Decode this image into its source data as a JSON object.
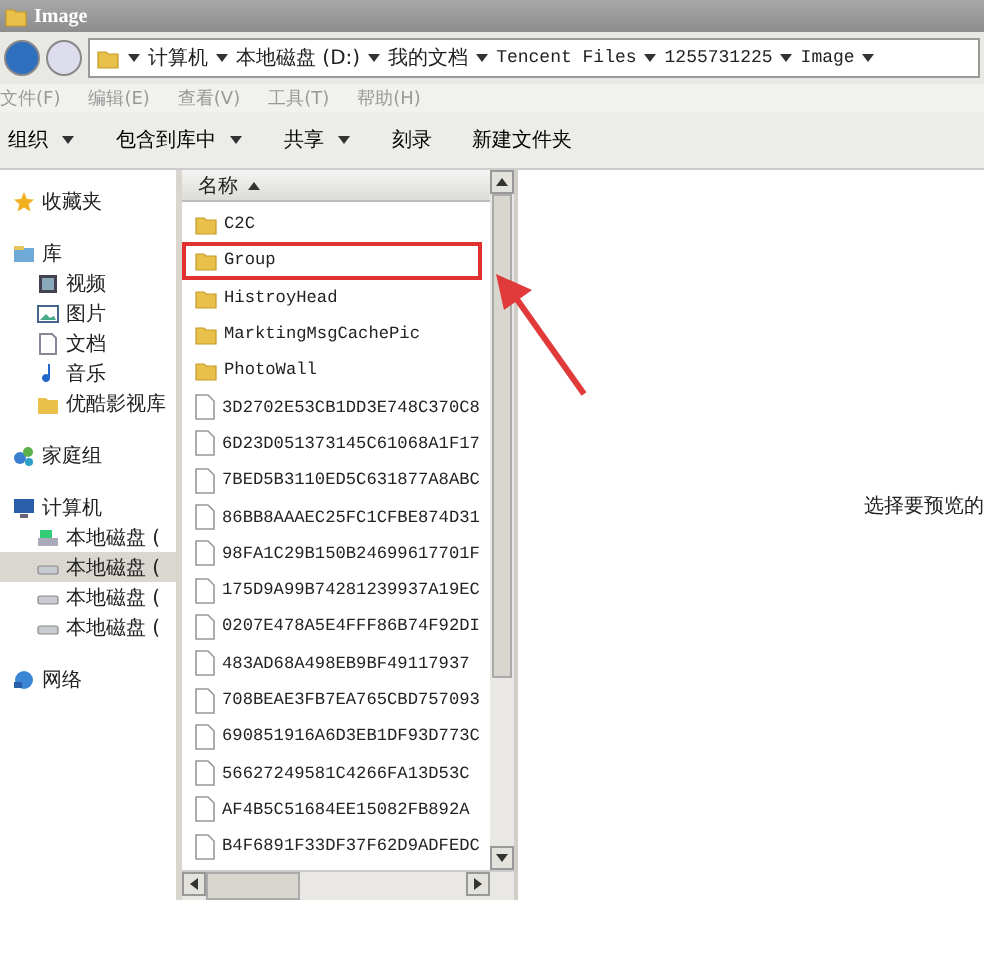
{
  "window": {
    "title": "Image"
  },
  "address": {
    "crumbs": [
      "计算机",
      "本地磁盘 (D:)",
      "我的文档",
      "Tencent Files",
      "1255731225",
      "Image"
    ]
  },
  "menu": [
    "文件(F)",
    "编辑(E)",
    "查看(V)",
    "工具(T)",
    "帮助(H)"
  ],
  "toolbar": [
    {
      "label": "组织",
      "dropdown": true
    },
    {
      "label": "包含到库中",
      "dropdown": true
    },
    {
      "label": "共享",
      "dropdown": true
    },
    {
      "label": "刻录",
      "dropdown": false
    },
    {
      "label": "新建文件夹",
      "dropdown": false
    }
  ],
  "sidebar": {
    "groups": [
      {
        "label": "收藏夹",
        "kind": "favorites",
        "selected": false
      },
      {
        "label": "库",
        "kind": "library",
        "selected": false,
        "children": [
          {
            "label": "视频",
            "kind": "video",
            "selected": false
          },
          {
            "label": "图片",
            "kind": "pictures",
            "selected": false
          },
          {
            "label": "文档",
            "kind": "documents",
            "selected": false
          },
          {
            "label": "音乐",
            "kind": "music",
            "selected": false
          },
          {
            "label": "优酷影视库",
            "kind": "folder",
            "selected": false
          }
        ]
      },
      {
        "label": "家庭组",
        "kind": "homegroup",
        "selected": false
      },
      {
        "label": "计算机",
        "kind": "computer",
        "selected": false,
        "children": [
          {
            "label": "本地磁盘 (",
            "kind": "system-drive",
            "selected": false
          },
          {
            "label": "本地磁盘 (",
            "kind": "drive",
            "selected": true
          },
          {
            "label": "本地磁盘 (",
            "kind": "drive",
            "selected": false
          },
          {
            "label": "本地磁盘 (",
            "kind": "drive",
            "selected": false
          }
        ]
      },
      {
        "label": "网络",
        "kind": "network",
        "selected": false
      }
    ]
  },
  "file_list": {
    "column": "名称",
    "items": [
      {
        "name": "C2C",
        "kind": "folder",
        "highlighted": false
      },
      {
        "name": "Group",
        "kind": "folder",
        "highlighted": true
      },
      {
        "name": "HistroyHead",
        "kind": "folder",
        "highlighted": false
      },
      {
        "name": "MarktingMsgCachePic",
        "kind": "folder",
        "highlighted": false
      },
      {
        "name": "PhotoWall",
        "kind": "folder",
        "highlighted": false
      },
      {
        "name": "3D2702E53CB1DD3E748C370C8",
        "kind": "file",
        "highlighted": false
      },
      {
        "name": "6D23D051373145C61068A1F17",
        "kind": "file",
        "highlighted": false
      },
      {
        "name": "7BED5B3110ED5C631877A8ABC",
        "kind": "file",
        "highlighted": false
      },
      {
        "name": "86BB8AAAEC25FC1CFBE874D31",
        "kind": "file",
        "highlighted": false
      },
      {
        "name": "98FA1C29B150B24699617701F",
        "kind": "file",
        "highlighted": false
      },
      {
        "name": "175D9A99B74281239937A19EC",
        "kind": "file",
        "highlighted": false
      },
      {
        "name": "0207E478A5E4FFF86B74F92DI",
        "kind": "file",
        "highlighted": false
      },
      {
        "name": "483AD68A498EB9BF49117937",
        "kind": "file",
        "highlighted": false
      },
      {
        "name": "708BEAE3FB7EA765CBD757093",
        "kind": "file",
        "highlighted": false
      },
      {
        "name": "690851916A6D3EB1DF93D773C",
        "kind": "file",
        "highlighted": false
      },
      {
        "name": "56627249581C4266FA13D53C",
        "kind": "file",
        "highlighted": false
      },
      {
        "name": "AF4B5C51684EE15082FB892A",
        "kind": "file",
        "highlighted": false
      },
      {
        "name": "B4F6891F33DF37F62D9ADFEDC",
        "kind": "file",
        "highlighted": false
      }
    ]
  },
  "preview": {
    "message": "选择要预览的"
  }
}
